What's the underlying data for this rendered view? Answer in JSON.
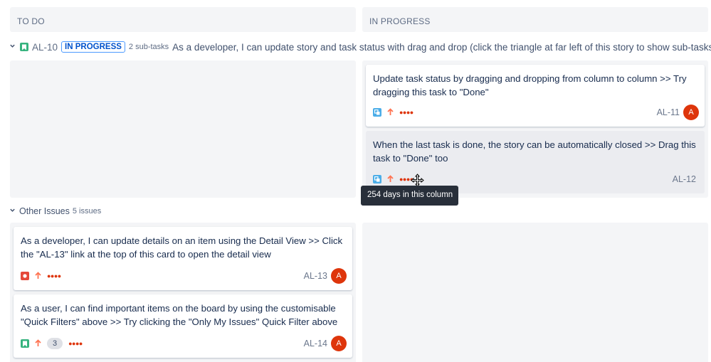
{
  "columns": {
    "todo": "TO DO",
    "in_progress": "IN PROGRESS"
  },
  "story": {
    "key": "AL-10",
    "status": "IN PROGRESS",
    "subtask_count": "2 sub-tasks",
    "summary": "As a developer, I can update story and task status with drag and drop (click the triangle at far left of this story to show sub-tasks)"
  },
  "other_issues": {
    "title": "Other Issues",
    "count": "5 issues"
  },
  "cards": {
    "al11": {
      "summary": "Update task status by dragging and dropping from column to column >> Try dragging this task to \"Done\"",
      "key": "AL-11",
      "avatar": "A",
      "type_icon": "subtask-icon",
      "priority_icon": "priority-high-icon",
      "estimate_dots": "●●●●"
    },
    "al12": {
      "summary": "When the last task is done, the story can be automatically closed >> Drag this task to \"Done\" too",
      "key": "AL-12",
      "type_icon": "subtask-icon",
      "priority_icon": "priority-high-icon",
      "estimate_dots": "●●●●"
    },
    "al13": {
      "summary": "As a developer, I can update details on an item using the Detail View >> Click the \"AL-13\" link at the top of this card to open the detail view",
      "key": "AL-13",
      "avatar": "A",
      "type_icon": "bug-icon",
      "priority_icon": "priority-high-icon",
      "estimate_dots": "●●●●"
    },
    "al14": {
      "summary": "As a user, I can find important items on the board by using the customisable \"Quick Filters\" above >> Try clicking the \"Only My Issues\" Quick Filter above",
      "key": "AL-14",
      "avatar": "A",
      "badge": "3",
      "type_icon": "story-icon",
      "priority_icon": "priority-high-icon",
      "estimate_dots": "●●●●"
    }
  },
  "tooltip": "254 days in this column",
  "colors": {
    "story": "#36b37e",
    "subtask": "#4bade8",
    "bug": "#e5493a",
    "avatar": "#de350b",
    "priority": "#ff7452",
    "lane_bg": "#f4f5f7"
  }
}
